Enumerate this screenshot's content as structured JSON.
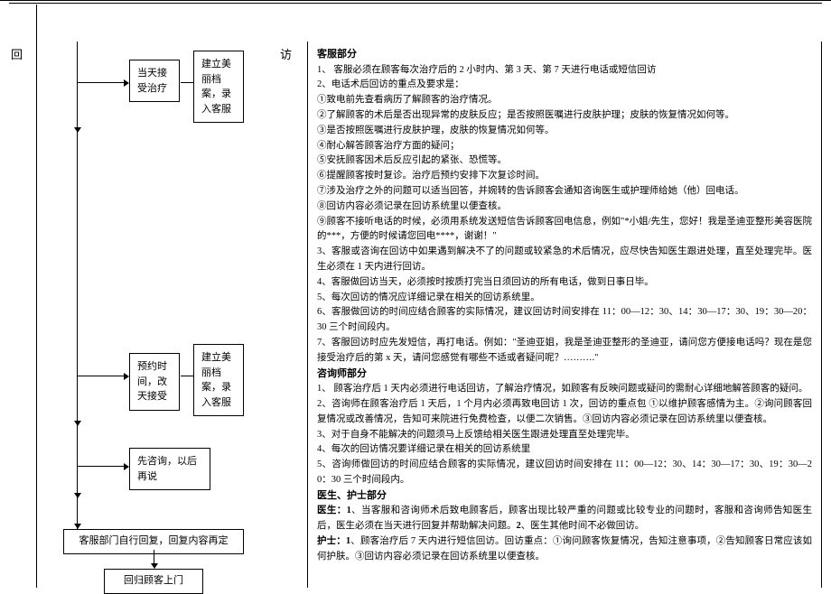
{
  "header": {
    "leftLabel": "回",
    "rightLabel": "访"
  },
  "flow": {
    "box1a": "当天接受治疗",
    "box1b": "建立美丽档案，录入客服",
    "box2a": "预约时间，改天接受",
    "box2b": "建立美丽档案，录入客服",
    "box3": "先咨询，以后再说",
    "box4": "客服部门自行回复，回复内容再定",
    "box5": "回归顾客上门"
  },
  "right": {
    "sec1_title": "客服部分",
    "s1_1": "1、 客服必须在顾客每次治疗后的 2 小时内、第 3 天、第 7 天进行电话或短信回访",
    "s1_2": "2、电话术后回访的重点及要求是：",
    "s1_2_1": "①致电前先查看病历了解顾客的治疗情况。",
    "s1_2_2": "②了解顾客的术后是否出现异常的皮肤反应；是否按照医嘱进行皮肤护理；皮肤的恢复情况如何等。",
    "s1_2_3": "③是否按照医嘱进行皮肤护理，皮肤的恢复情况如何等。",
    "s1_2_4": "④耐心解答顾客治疗方面的疑问；",
    "s1_2_5": "⑤安抚顾客因术后反应引起的紧张、恐慌等。",
    "s1_2_6": "⑥提醒顾客按时复诊。治疗后预约安排下次复诊时间。",
    "s1_2_7": "⑦涉及治疗之外的问题可以适当回答，并婉转的告诉顾客会通知咨询医生或护理师给她（他）回电话。",
    "s1_2_8": "⑧回访内容必须记录在回访系统里以便查核。",
    "s1_2_9": "⑨顾客不接听电话的时候，必须用系统发送短信告诉顾客回电信息，例如\"*小姐/先生，您好！我是圣迪亚整形美容医院的***，方便的时候请您回电****，谢谢！\"",
    "s1_3": "3、客服或咨询在回访中如果遇到解决不了的问题或较紧急的术后情况，应尽快告知医生跟进处理，直至处理完毕。医生必须在 1 天内进行回访。",
    "s1_4": "4、客服做回访当天，必须按时按质打完当日须回访的所有电话，做到日事日毕。",
    "s1_5": "5、每次回访的情况应详细记录在相关的回访系统里。",
    "s1_6": "6、客服做回访的时间应结合顾客的实际情况，建议回访时间安排在 11：00—12：30、14：30—17：30、19：30—20：30 三个时间段内。",
    "s1_7": "7、客服回访时应先发短信，再打电话。例如：\"圣迪亚姐，我是圣迪亚整形的圣迪亚，请问您方便接电话吗？现在是您接受治疗后的第 x 天，请问您感觉有哪些不适或者疑问呢？……….\"",
    "sec2_title": "咨询师部分",
    "s2_1": "1、 顾客治疗后 1 天内必须进行电话回访，了解治疗情况，如顾客有反映问题或疑问的需耐心详细地解答顾客的疑问。",
    "s2_2": "2、咨询师在顾客治疗后 1 天后，1 个月内必须再致电回访 1 次，回访的重点包 ①以维护顾客感情为主。②询问顾客回复情况或改善情况，告知可来院进行免费检查，以便二次销售。③回访内容必须记录在回访系统里以便查核。",
    "s2_3": "3、对于自身不能解决的问题须马上反馈给相关医生跟进处理直至处理完毕。",
    "s2_4": "4、每次的回访情况要详细记录在相关的回访系统里",
    "s2_5": "5、咨询师做回访的时间应结合顾客的实际情况，建议回访时间安排在 11：00—12：30、14：30—17：30、19：30—20：30 三个时间段内。",
    "sec3_title": "医生、护士部分",
    "s3_1a": "医生：1",
    "s3_1b": "、当客服和咨询师术后致电顾客后，顾客出现比较严重的问题或比较专业的问题时，客服和咨询师告知医生后，医生必须在当天进行回复并帮助解决问题。",
    "s3_1c": "2",
    "s3_1d": "、医生其他时间不必做回访。",
    "s3_2a": "护士：1",
    "s3_2b": "、顾客治疗后 7 天内进行短信回访。回访重点：①询问顾客恢复情况，告知注意事项，②告知顾客日常应该如何护肤。③回访内容必须记录在回访系统里以便查核。"
  }
}
